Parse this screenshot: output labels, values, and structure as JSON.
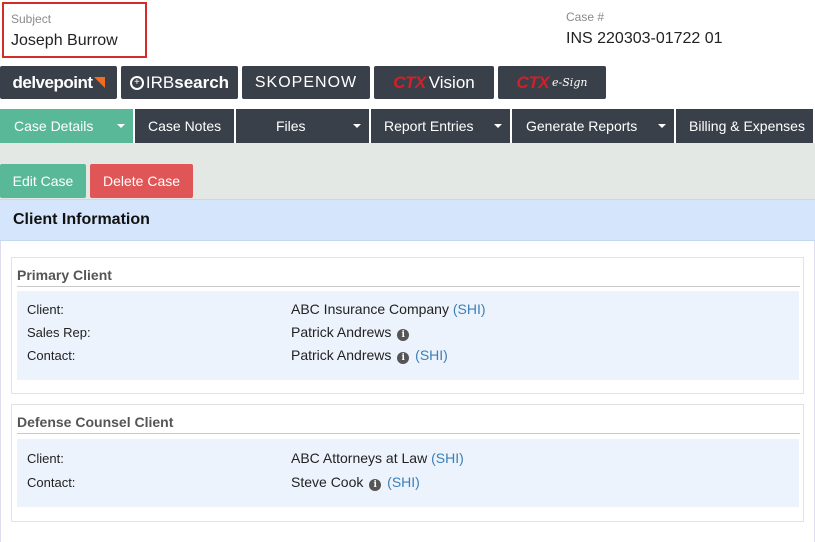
{
  "header": {
    "subject_label": "Subject",
    "subject_value": "Joseph Burrow",
    "case_label": "Case #",
    "case_value": "INS 220303-01722 01"
  },
  "integrations": {
    "delvepoint": "delvepoint",
    "irb_prefix": "IRB",
    "irb_suffix": "search",
    "skopenow": "SKOPENOW",
    "ctx_brand": "CTX",
    "ctx_vision": "Vision",
    "ctx_esign_brand": "CTX",
    "ctx_esign": "e-Sign"
  },
  "nav": {
    "tabs": [
      {
        "label": "Case Details",
        "dropdown": true,
        "active": true
      },
      {
        "label": "Case Notes",
        "dropdown": false
      },
      {
        "label": "Files",
        "dropdown": true
      },
      {
        "label": "Report Entries",
        "dropdown": true
      },
      {
        "label": "Generate Reports",
        "dropdown": true
      },
      {
        "label": "Billing & Expenses",
        "dropdown": false
      }
    ]
  },
  "actions": {
    "edit_label": "Edit Case",
    "delete_label": "Delete Case"
  },
  "client_info": {
    "title": "Client Information",
    "primary": {
      "title": "Primary Client",
      "client_label": "Client:",
      "client_value": "ABC Insurance Company",
      "client_link": "(SHI)",
      "sales_rep_label": "Sales Rep:",
      "sales_rep_value": "Patrick Andrews",
      "contact_label": "Contact:",
      "contact_value": "Patrick Andrews",
      "contact_link": "(SHI)"
    },
    "defense": {
      "title": "Defense Counsel Client",
      "client_label": "Client:",
      "client_value": "ABC Attorneys at Law",
      "client_link": "(SHI)",
      "contact_label": "Contact:",
      "contact_value": "Steve Cook",
      "contact_link": "(SHI)"
    }
  },
  "colors": {
    "accent_green": "#59b898",
    "danger_red": "#e05555",
    "dark_tab": "#3a4049",
    "panel_blue": "#d5e5fb",
    "link_blue": "#3a7fb8"
  }
}
